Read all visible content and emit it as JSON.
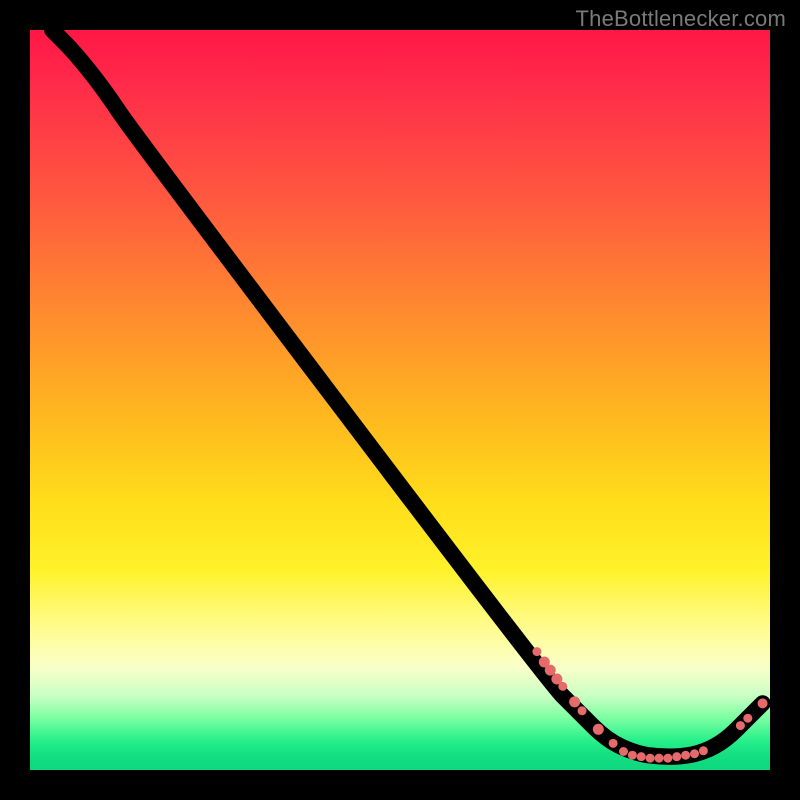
{
  "attribution": "TheBottlenecker.com",
  "chart_data": {
    "type": "line",
    "title": "",
    "xlabel": "",
    "ylabel": "",
    "xlim": [
      0,
      100
    ],
    "ylim": [
      0,
      100
    ],
    "curve": [
      {
        "x": 3,
        "y": 100
      },
      {
        "x": 6,
        "y": 97
      },
      {
        "x": 10,
        "y": 92
      },
      {
        "x": 14,
        "y": 86
      },
      {
        "x": 70,
        "y": 12
      },
      {
        "x": 74,
        "y": 8
      },
      {
        "x": 78,
        "y": 4
      },
      {
        "x": 82,
        "y": 2.2
      },
      {
        "x": 85,
        "y": 1.8
      },
      {
        "x": 88,
        "y": 1.8
      },
      {
        "x": 91,
        "y": 2.4
      },
      {
        "x": 94,
        "y": 4
      },
      {
        "x": 97,
        "y": 7
      },
      {
        "x": 99,
        "y": 9
      }
    ],
    "series": [
      {
        "name": "points",
        "color": "#e66a6a",
        "values": [
          {
            "x": 68.5,
            "y": 16.0,
            "r": 4.5
          },
          {
            "x": 69.5,
            "y": 14.6,
            "r": 5.5
          },
          {
            "x": 70.3,
            "y": 13.5,
            "r": 5.5
          },
          {
            "x": 71.2,
            "y": 12.3,
            "r": 5.5
          },
          {
            "x": 72.0,
            "y": 11.3,
            "r": 4.5
          },
          {
            "x": 73.6,
            "y": 9.2,
            "r": 5.5
          },
          {
            "x": 74.6,
            "y": 8.0,
            "r": 4.5
          },
          {
            "x": 76.8,
            "y": 5.5,
            "r": 5.5
          },
          {
            "x": 78.8,
            "y": 3.6,
            "r": 4.5
          },
          {
            "x": 80.2,
            "y": 2.5,
            "r": 4.5
          },
          {
            "x": 81.4,
            "y": 2.0,
            "r": 4.5
          },
          {
            "x": 82.6,
            "y": 1.8,
            "r": 4.5
          },
          {
            "x": 83.8,
            "y": 1.6,
            "r": 4.5
          },
          {
            "x": 85.0,
            "y": 1.6,
            "r": 4.5
          },
          {
            "x": 86.2,
            "y": 1.6,
            "r": 4.5
          },
          {
            "x": 87.4,
            "y": 1.8,
            "r": 4.5
          },
          {
            "x": 88.6,
            "y": 2.0,
            "r": 4.5
          },
          {
            "x": 89.8,
            "y": 2.2,
            "r": 4.5
          },
          {
            "x": 91.0,
            "y": 2.6,
            "r": 4.5
          },
          {
            "x": 96.0,
            "y": 6.0,
            "r": 4.5
          },
          {
            "x": 97.0,
            "y": 7.0,
            "r": 4.5
          },
          {
            "x": 99.0,
            "y": 9.0,
            "r": 5.0
          }
        ]
      }
    ]
  }
}
